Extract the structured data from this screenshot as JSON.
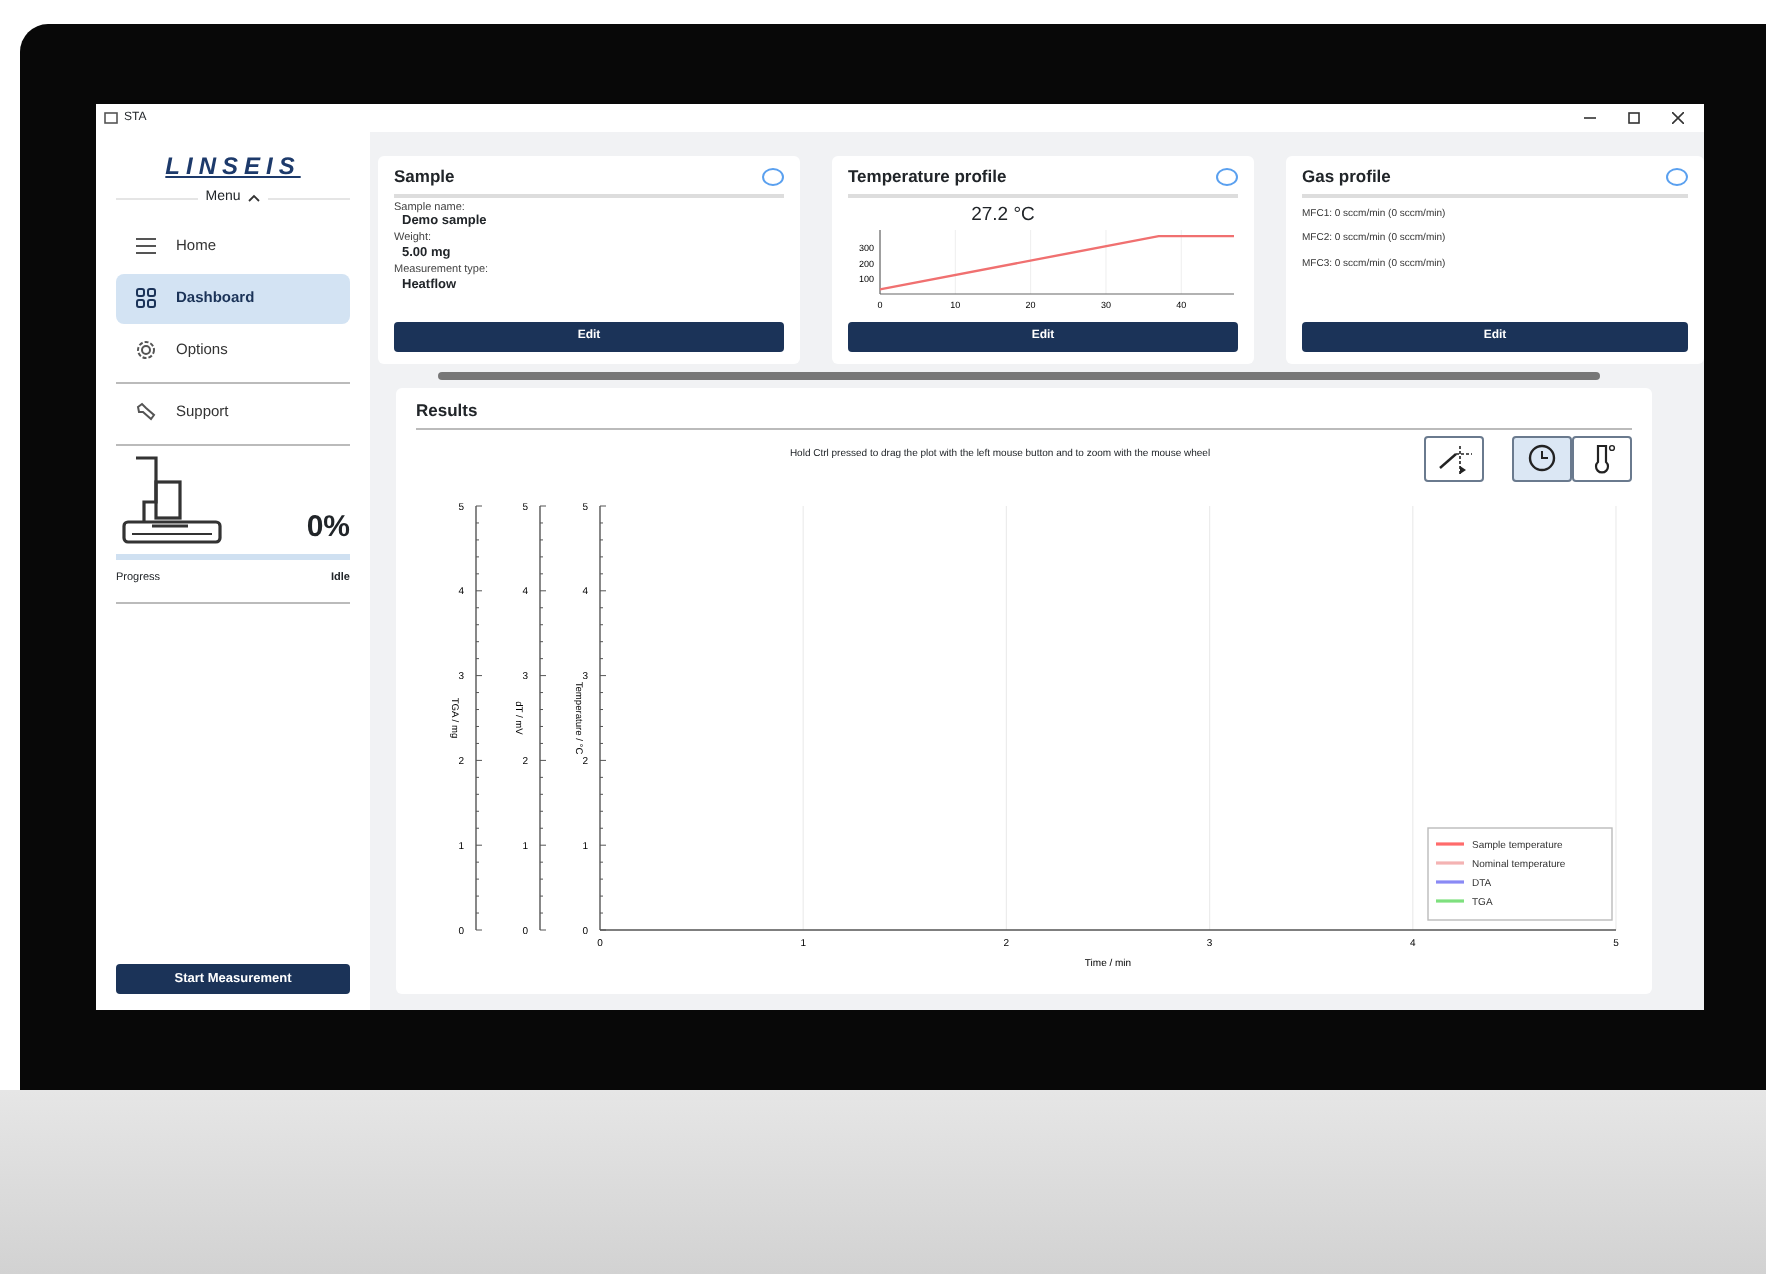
{
  "window": {
    "title": "STA"
  },
  "sidebar": {
    "logo": "LINSEIS",
    "menu_label": "Menu",
    "menu_expanded": true,
    "items": [
      {
        "label": "Home",
        "selected": false
      },
      {
        "label": "Dashboard",
        "selected": true
      },
      {
        "label": "Options",
        "selected": false
      }
    ],
    "support_items": [
      {
        "label": "Support",
        "selected": false
      }
    ],
    "progress": {
      "percent": "0%",
      "level": 0,
      "label": "Progress",
      "status": "Idle"
    },
    "start_button": "Start Measurement"
  },
  "sample": {
    "title": "Sample",
    "fields": [
      {
        "label": "Sample name:",
        "value": "Demo sample"
      },
      {
        "label": "Weight:",
        "value": "5.00 mg"
      },
      {
        "label": "Measurement type:",
        "value": "Heatflow"
      }
    ],
    "button": "Edit"
  },
  "temperature_profile": {
    "title": "Temperature profile",
    "reading": "27.2 °C",
    "button": "Edit",
    "chart_data": {
      "type": "line",
      "x": [
        0,
        37,
        47
      ],
      "series": [
        {
          "color": "#f07070",
          "values": [
            30,
            380,
            380
          ]
        }
      ],
      "grid": true,
      "xlim": [
        0,
        47
      ],
      "ylim": [
        0,
        420
      ],
      "xticks": [
        0,
        10,
        20,
        30,
        40
      ],
      "yticks": [
        100,
        200,
        300
      ]
    }
  },
  "gas_profile": {
    "title": "Gas profile",
    "lines": [
      "MFC1: 0 sccm/min (0 sccm/min)",
      "MFC2: 0 sccm/min (0 sccm/min)",
      "MFC3: 0 sccm/min (0 sccm/min)"
    ],
    "button": "Edit"
  },
  "results": {
    "title": "Results",
    "hint": "Hold Ctrl pressed to drag the plot with the left mouse button and to zoom with the mouse wheel",
    "tools": [
      {
        "kind": "cursor",
        "selected": false
      }
    ],
    "axis_modes": [
      {
        "kind": "time",
        "selected": true
      },
      {
        "kind": "temperature",
        "selected": false
      }
    ],
    "plot": {
      "grid": true,
      "x_axis": {
        "label": "Time / min",
        "ticks": [
          "0",
          "1",
          "2",
          "3",
          "4",
          "5"
        ]
      },
      "y_axes": [
        {
          "label": "TGA / mg",
          "ticks": [
            "5",
            "4",
            "3",
            "2",
            "1",
            "0"
          ]
        },
        {
          "label": "dT / mV",
          "ticks": [
            "5",
            "4",
            "3",
            "2",
            "1",
            "0"
          ]
        },
        {
          "label": "Temperature / °C",
          "ticks": [
            "5",
            "4",
            "3",
            "2",
            "1",
            "0"
          ]
        }
      ],
      "legend": [
        {
          "name": "Sample temperature",
          "color": "#ff6b6b"
        },
        {
          "name": "Nominal temperature",
          "color": "#f4b3b3"
        },
        {
          "name": "DTA",
          "color": "#8a8af5"
        },
        {
          "name": "TGA",
          "color": "#7ee07e"
        }
      ]
    }
  }
}
